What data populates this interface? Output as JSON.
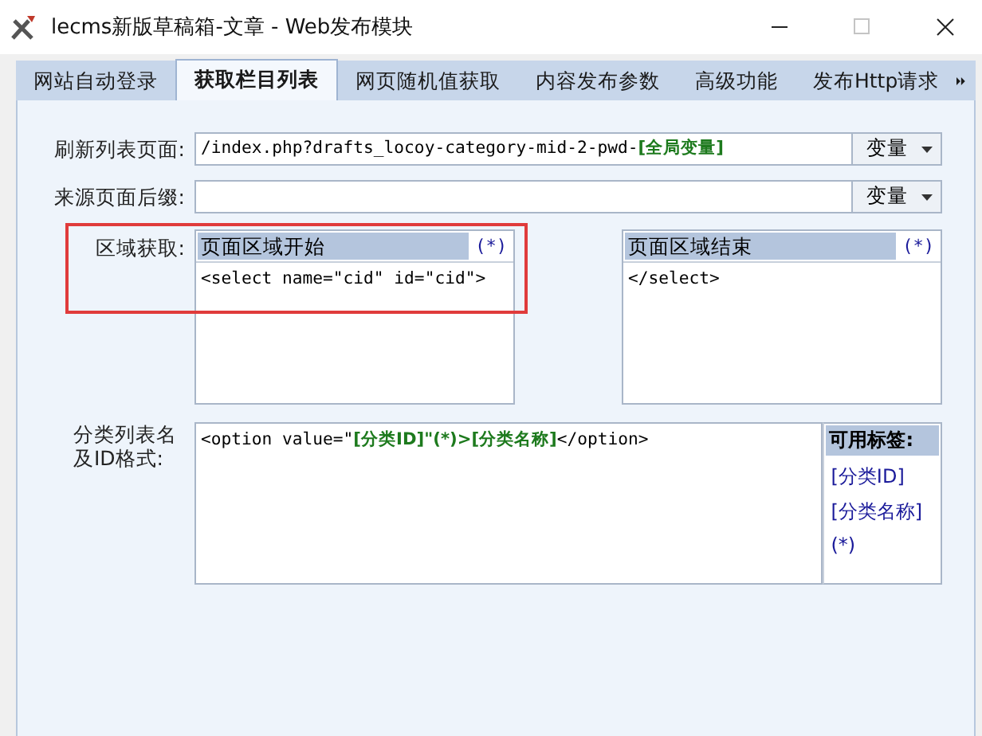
{
  "window": {
    "title": "lecms新版草稿箱-文章 - Web发布模块",
    "maximize_disabled": true
  },
  "tabs": [
    {
      "label": "网站自动登录",
      "selected": false
    },
    {
      "label": "获取栏目列表",
      "selected": true
    },
    {
      "label": "网页随机值获取",
      "selected": false
    },
    {
      "label": "内容发布参数",
      "selected": false
    },
    {
      "label": "高级功能",
      "selected": false
    },
    {
      "label": "发布Http请求",
      "selected": false
    }
  ],
  "fields": [
    {
      "label": "刷新列表页面:",
      "value": "/index.php?drafts_locoy-category-mid-2-pwd-**[全局变量]**",
      "button": "变量"
    },
    {
      "label": "来源页面后缀:",
      "button": "变量"
    }
  ],
  "region": {
    "label": "区域获取:",
    "highlighted": true,
    "start": {
      "title": "页面区域开始",
      "wildcard": "(*)",
      "value": "<select name=\"cid\" id=\"cid\">"
    },
    "end": {
      "title": "页面区域结束",
      "wildcard": "(*)",
      "value": "</select>"
    }
  },
  "format": {
    "label": "分类列表名及ID格式:",
    "value": "<option value=\"**[分类ID]\"(*)>[分类名称]**</option>",
    "tags_title": "可用标签:",
    "tags": [
      "[分类ID]",
      "[分类名称]",
      "(*)"
    ]
  }
}
